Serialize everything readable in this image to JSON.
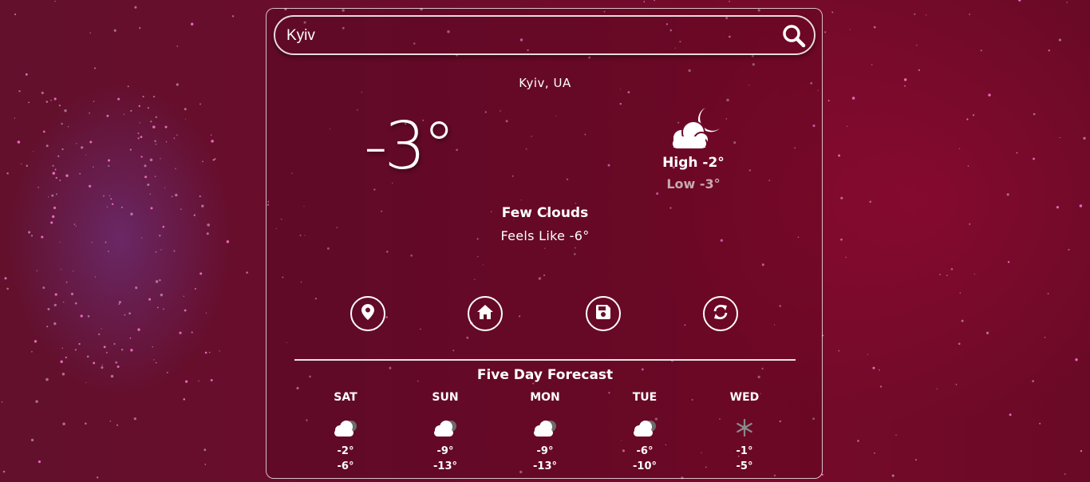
{
  "search": {
    "value": "Kyiv",
    "placeholder": ""
  },
  "current": {
    "location": "Kyiv, UA",
    "temperature": "-3°",
    "condition_icon": "few-clouds-night-icon",
    "high": "High -2°",
    "low": "Low -3°",
    "description": "Few Clouds",
    "feels_like": "Feels Like -6°"
  },
  "actions": [
    {
      "name": "location-button",
      "icon": "map-pin-icon"
    },
    {
      "name": "home-button",
      "icon": "home-icon"
    },
    {
      "name": "save-button",
      "icon": "floppy-disk-icon"
    },
    {
      "name": "refresh-button",
      "icon": "refresh-icon"
    }
  ],
  "forecast": {
    "title": "Five Day Forecast",
    "days": [
      {
        "name": "SAT",
        "icon": "cloudy-icon",
        "high": "-2°",
        "low": "-6°"
      },
      {
        "name": "SUN",
        "icon": "cloudy-icon",
        "high": "-9°",
        "low": "-13°"
      },
      {
        "name": "MON",
        "icon": "cloudy-icon",
        "high": "-9°",
        "low": "-13°"
      },
      {
        "name": "TUE",
        "icon": "cloudy-icon",
        "high": "-6°",
        "low": "-10°"
      },
      {
        "name": "WED",
        "icon": "snowflake-icon",
        "high": "-1°",
        "low": "-5°"
      }
    ]
  },
  "colors": {
    "background": "#6c0c2c",
    "accent": "#ffffff",
    "muted": "#c7a9b1"
  }
}
